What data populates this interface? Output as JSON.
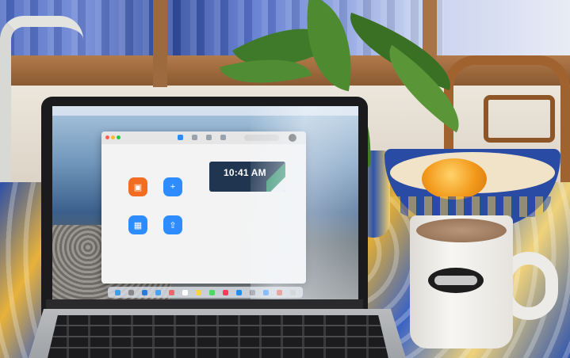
{
  "zoom_home": {
    "clock_time": "10:41 AM",
    "buttons": [
      {
        "icon": "camera-icon",
        "color": "#f26d21"
      },
      {
        "icon": "plus-icon",
        "color": "#2d8cff"
      },
      {
        "icon": "calendar-icon",
        "color": "#2d8cff"
      },
      {
        "icon": "share-screen-icon",
        "color": "#2d8cff"
      }
    ]
  },
  "colors": {
    "zoom_orange": "#f26d21",
    "zoom_blue": "#2d8cff",
    "tablecloth_blue": "#2c4fa8",
    "tablecloth_yellow": "#e8b23a"
  }
}
